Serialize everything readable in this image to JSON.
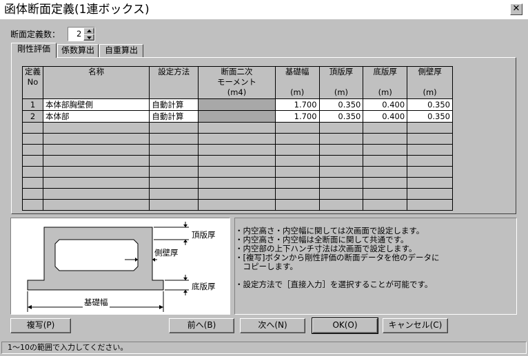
{
  "window": {
    "title": "函体断面定義(1連ボックス)",
    "close_glyph": "✕"
  },
  "section_count": {
    "label": "断面定義数：",
    "value": "2"
  },
  "tabs": [
    {
      "label": "剛性評価"
    },
    {
      "label": "係数算出"
    },
    {
      "label": "自重算出"
    }
  ],
  "table": {
    "headers": [
      [
        "定義",
        "No"
      ],
      [
        "名称"
      ],
      [
        "設定方法"
      ],
      [
        "断面二次",
        "モーメント",
        "(m4)"
      ],
      [
        "基礎幅",
        "",
        "(m)"
      ],
      [
        "頂版厚",
        "",
        "(m)"
      ],
      [
        "底版厚",
        "",
        "(m)"
      ],
      [
        "側壁厚",
        "",
        "(m)"
      ]
    ],
    "rows": [
      {
        "no": "1",
        "name": "本体部胸壁側",
        "method": "自動計算",
        "moment": "",
        "base_width": "1.700",
        "top_slab": "0.350",
        "bottom_slab": "0.400",
        "side_wall": "0.350"
      },
      {
        "no": "2",
        "name": "本体部",
        "method": "自動計算",
        "moment": "",
        "base_width": "1.700",
        "top_slab": "0.350",
        "bottom_slab": "0.400",
        "side_wall": "0.350"
      }
    ],
    "empty_rows": 8
  },
  "diagram": {
    "top_slab_label": "頂版厚",
    "side_wall_label": "側壁厚",
    "bottom_slab_label": "底版厚",
    "base_width_label": "基礎幅"
  },
  "notes": [
    "・内空高さ・内空幅に関しては次画面で設定します。",
    "・内空高さ・内空幅は全断面に関して共通です。",
    "・内空部の上下ハンチ寸法は次画面で設定します。",
    "・[複写]ボタンから剛性評価の断面データを他のデータに",
    "　コピーします。",
    "・設定方法で［直接入力］を選択することが可能です。"
  ],
  "buttons": {
    "copy": "複写(P)",
    "prev": "前へ(B)",
    "next": "次へ(N)",
    "ok": "OK(O)",
    "cancel": "キャンセル(C)"
  },
  "status": "1～10の範囲で入力してください。"
}
